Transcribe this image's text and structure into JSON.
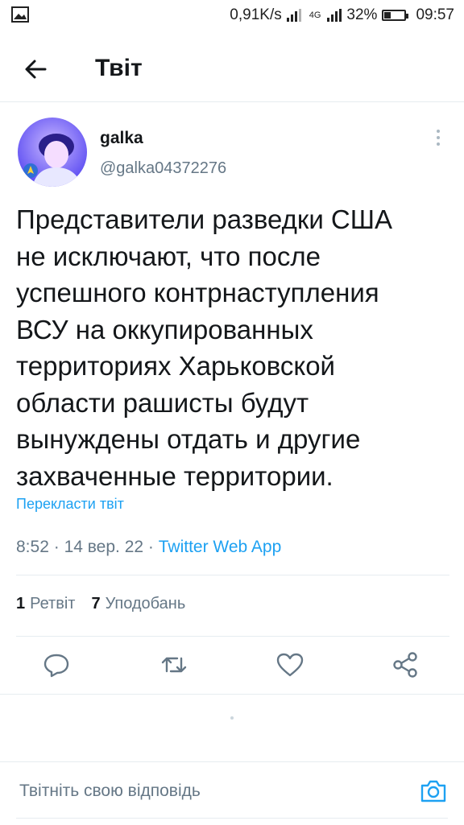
{
  "status_bar": {
    "speed": "0,91K/s",
    "network": "4G",
    "battery": "32%",
    "battery_level": 0.32,
    "time": "09:57",
    "icons": [
      "image-icon",
      "signal-icon",
      "battery-icon"
    ]
  },
  "header": {
    "title": "Твіт",
    "back_icon": "arrow-left-icon"
  },
  "tweet": {
    "author_name": "galka",
    "author_handle": "@galka04372276",
    "text": "Представители разведки США\nне исключают, что после\nуспешного контрнаступления\nВСУ на оккупированных\nтерриториях Харьковской\nобласти рашисты будут\nвынуждены отдать и другие\nзахваченные территории.",
    "translate_label": "Перекласти твіт",
    "time": "8:52",
    "date": "14 вер. 22",
    "separator": "·",
    "source": "Twitter Web App"
  },
  "stats": {
    "retweets_count": "1",
    "retweets_label": "Ретвіт",
    "likes_count": "7",
    "likes_label": "Уподобань"
  },
  "actions": [
    "reply-icon",
    "retweet-icon",
    "like-icon",
    "share-icon"
  ],
  "reply": {
    "placeholder": "Твітніть свою відповідь",
    "camera_icon": "camera-icon"
  },
  "colors": {
    "accent": "#1da1f2",
    "text": "#14171a",
    "secondary": "#657786",
    "divider": "#e6ecf0"
  }
}
